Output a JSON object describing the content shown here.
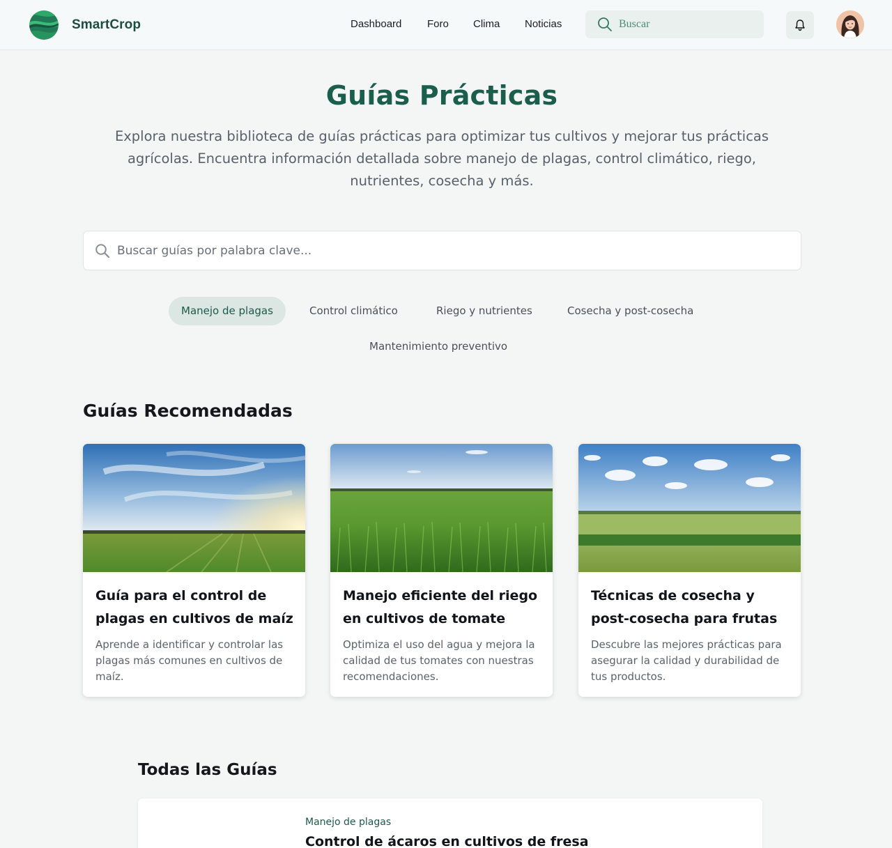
{
  "header": {
    "brand": "SmartCrop",
    "nav": [
      "Dashboard",
      "Foro",
      "Clima",
      "Noticias"
    ],
    "search_placeholder": "Buscar"
  },
  "hero": {
    "title": "Guías Prácticas",
    "intro": "Explora nuestra biblioteca de guías prácticas para optimizar tus cultivos y mejorar tus prácticas agrícolas. Encuentra información detallada sobre manejo de plagas, control climático, riego, nutrientes, cosecha y más.",
    "search_placeholder": "Buscar guías por palabra clave..."
  },
  "filters": [
    {
      "label": "Manejo de plagas",
      "active": true
    },
    {
      "label": "Control climático",
      "active": false
    },
    {
      "label": "Riego y nutrientes",
      "active": false
    },
    {
      "label": "Cosecha y post-cosecha",
      "active": false
    },
    {
      "label": "Mantenimiento preventivo",
      "active": false
    }
  ],
  "recommended": {
    "title": "Guías Recomendadas",
    "cards": [
      {
        "title": "Guía para el control de plagas en cultivos de maíz",
        "description": "Aprende a identificar y controlar las plagas más comunes en cultivos de maíz.",
        "image": "sunset-field-image"
      },
      {
        "title": "Manejo eficiente del riego en cultivos de tomate",
        "description": "Optimiza el uso del agua y mejora la calidad de tus tomates con nuestras recomendaciones.",
        "image": "green-crop-field-image"
      },
      {
        "title": "Técnicas de cosecha y post-cosecha para frutas",
        "description": "Descubre las mejores prácticas para asegurar la calidad y durabilidad de tus productos.",
        "image": "meadow-clouds-image"
      }
    ]
  },
  "all_guides": {
    "title": "Todas las Guías",
    "items": [
      {
        "category": "Manejo de plagas",
        "title": "Control de ácaros en cultivos de fresa"
      }
    ]
  },
  "colors": {
    "brand": "#1d4d3e",
    "accent": "#1b5e4b",
    "chip_active_bg": "#dce6e3",
    "page_bg": "#f4f6f5"
  }
}
